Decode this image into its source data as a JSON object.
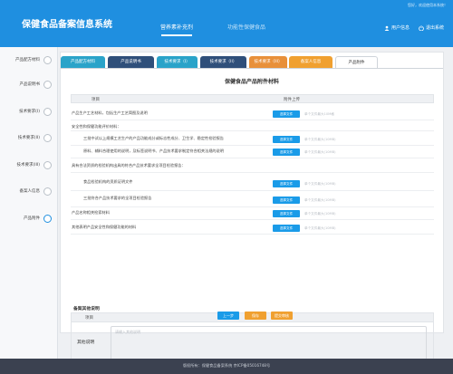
{
  "header": {
    "note": "您好，欢迎使用本系统！",
    "title": "保健食品备案信息系统",
    "nav": [
      "营养素补充剂",
      "功能性保健食品"
    ],
    "user": "用户信息",
    "logout": "退出系统"
  },
  "sidebar": {
    "steps": [
      "产品配方材料",
      "产品说明书",
      "技术要求(I)",
      "技术要求(II)",
      "技术要求(III)",
      "备案人信息",
      "产品附件"
    ]
  },
  "tabs": [
    {
      "label": "产品配方材料",
      "color": "#2aa3c9"
    },
    {
      "label": "产品说明书",
      "color": "#2f4f7a"
    },
    {
      "label": "技术要求（I）",
      "color": "#2aa3c9"
    },
    {
      "label": "技术要求（II）",
      "color": "#2f4f7a"
    },
    {
      "label": "技术要求（III）",
      "color": "#e8903a"
    },
    {
      "label": "备案人信息",
      "color": "#f0a030"
    },
    {
      "label": "产品附件",
      "color": "#ffffff"
    }
  ],
  "main": {
    "heading": "保健食品产品附件材料",
    "col_item": "项目",
    "col_upload": "附件上传",
    "rows": [
      {
        "label": "产品生产工艺材料，包括生产工艺简图及说明",
        "indent": false,
        "button": "选择文件",
        "hint": "单个文件最大10M格"
      },
      {
        "label": "安全性和保健功能评价材料：",
        "indent": false,
        "button": "",
        "hint": ""
      },
      {
        "label": "三批中试以上规模工艺生产的产品功能成分或标志性成分、卫生学、稳定性检验报告",
        "indent": true,
        "button": "选择文件",
        "hint": "单个文件最大(10MB)"
      },
      {
        "label": "原料、辅料合理使用的说明，及标签说明书、产品技术要求制定符合相关法规的说明",
        "indent": true,
        "button": "选择文件",
        "hint": "单个文件最大(10MB)"
      },
      {
        "label": "具有合法资质的检验机构出具的符合产品技术要求全项目检验报告：",
        "indent": false,
        "button": "",
        "hint": ""
      },
      {
        "label": "食品检验机构的资质证明文件",
        "indent": true,
        "button": "选择文件",
        "hint": "单个文件最大(10MB)"
      },
      {
        "label": "三批符合产品技术要求的全项目检验报告",
        "indent": true,
        "button": "选择文件",
        "hint": "单个文件最大(10MB)"
      },
      {
        "label": "产品名称相关检索材料",
        "indent": false,
        "button": "选择文件",
        "hint": "单个文件最大(10MB)"
      },
      {
        "label": "其他表明产品安全性和保健功能的材料",
        "indent": false,
        "button": "选择文件",
        "hint": "单个文件最大(10MB)"
      }
    ],
    "other_title": "备案其他说明",
    "other_col": "项目",
    "other_label": "其他说明",
    "other_placeholder": "请输入其他说明"
  },
  "actions": [
    {
      "label": "上一步",
      "color": "#1a9be8"
    },
    {
      "label": "保存",
      "color": "#f0a030"
    },
    {
      "label": "提交审核",
      "color": "#f0a030"
    }
  ],
  "footer": "版权所有：保健食品备案系统  京ICP备05016748号"
}
